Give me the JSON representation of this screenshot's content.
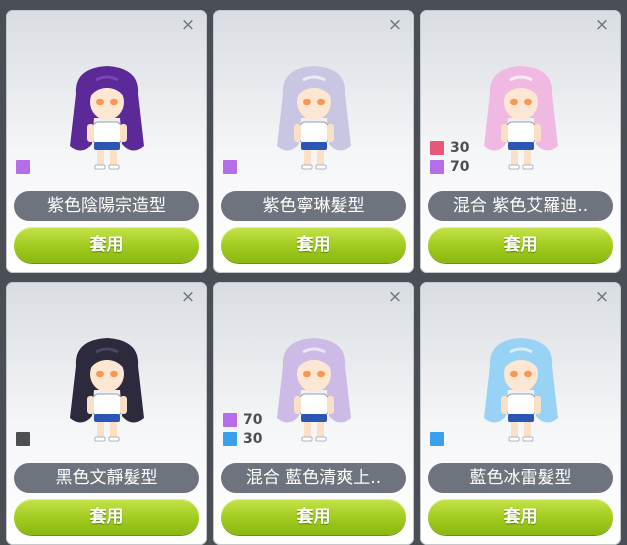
{
  "close_glyph": "×",
  "cards": [
    {
      "name": "紫色陰陽宗造型",
      "button": "套用",
      "hair_color": "#5b2a98",
      "hair_light": "#7a44b8",
      "swatches": [
        {
          "color": "#b46ee8",
          "value": ""
        }
      ]
    },
    {
      "name": "紫色寧琳髮型",
      "button": "套用",
      "hair_color": "#c9c6e4",
      "hair_light": "#eceaf7",
      "swatches": [
        {
          "color": "#b46ee8",
          "value": ""
        }
      ]
    },
    {
      "name": "混合 紫色艾羅迪..",
      "button": "套用",
      "hair_color": "#f0b9e2",
      "hair_light": "#fbe9f6",
      "swatches": [
        {
          "color": "#e8577a",
          "value": "30"
        },
        {
          "color": "#b46ee8",
          "value": "70"
        }
      ]
    },
    {
      "name": "黑色文靜髮型",
      "button": "套用",
      "hair_color": "#2c2a3c",
      "hair_light": "#4a4760",
      "swatches": [
        {
          "color": "#4d4f52",
          "value": ""
        }
      ]
    },
    {
      "name": "混合 藍色清爽上..",
      "button": "套用",
      "hair_color": "#cbbbe6",
      "hair_light": "#ebe4f6",
      "swatches": [
        {
          "color": "#b46ee8",
          "value": "70"
        },
        {
          "color": "#3aa0ee",
          "value": "30"
        }
      ]
    },
    {
      "name": "藍色冰雷髮型",
      "button": "套用",
      "hair_color": "#98d2f4",
      "hair_light": "#d7eefb",
      "swatches": [
        {
          "color": "#3aa0ee",
          "value": ""
        }
      ]
    }
  ]
}
